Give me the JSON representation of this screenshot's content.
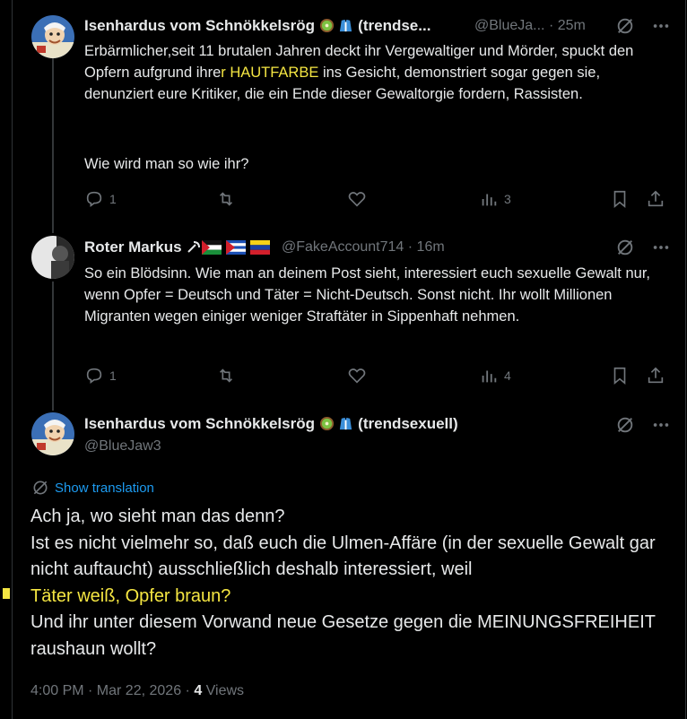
{
  "tweet1": {
    "name": "Isenhardus vom Schnökkelsrög",
    "name_suffix": "(trendse...",
    "handle": "@BlueJa...",
    "time": "· 25m",
    "text_a": "Erbärmlicher,seit 11 brutalen Jahren deckt ihr Vergewaltiger und Mörder, spuckt den Opfern aufgrund ihre",
    "text_hl": "r HAUTFARBE",
    "text_b": " ins Gesicht, demonstriert sogar gegen sie, denunziert eure Kritiker, die ein Ende dieser Gewaltorgie fordern, Rassisten.",
    "text_c": "Wie wird man so wie ihr?",
    "replies": "1",
    "views": "3"
  },
  "tweet2": {
    "name": "Roter Markus",
    "handle": "@FakeAccount714",
    "time": "· 16m",
    "text": "So ein Blödsinn. Wie man an deinem Post sieht, interessiert euch sexuelle Gewalt nur, wenn Opfer = Deutsch und Täter = Nicht-Deutsch. Sonst nicht. Ihr wollt Millionen Migranten wegen einiger weniger Straftäter in Sippenhaft nehmen.",
    "replies": "1",
    "views": "4"
  },
  "main": {
    "name": "Isenhardus vom Schnökkelsrög",
    "name_suffix": "(trendsexuell)",
    "handle": "@BlueJaw3",
    "show_translation": "Show translation",
    "line1": "Ach ja, wo sieht man das denn?",
    "line2": "Ist es nicht vielmehr so, daß euch die Ulmen-Affäre (in der sexuelle Gewalt gar nicht auftaucht) ausschließlich deshalb interessiert, weil",
    "line3_hl": "Täter weiß, Opfer braun?",
    "line4": "Und ihr unter diesem Vorwand neue Gesetze gegen die MEINUNGSFREIHEIT raushaun wollt?",
    "time": "4:00 PM · Mar 22, 2026 · ",
    "views_count": "4",
    "views_label": " Views"
  },
  "colors": {
    "background": "#000000",
    "text": "#e7e9ea",
    "muted": "#71767b",
    "link": "#1d9bf0",
    "highlight": "#f5e642"
  }
}
